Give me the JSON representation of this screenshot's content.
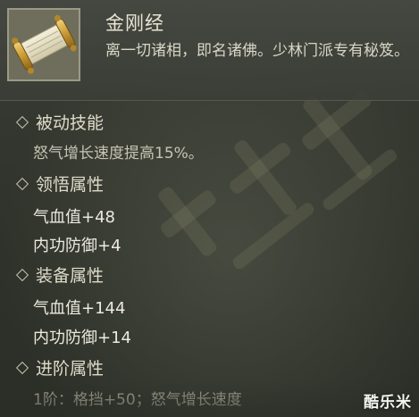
{
  "item": {
    "name": "金刚经",
    "description": "离一切诸相，即名诸佛。少林门派专有秘笈。",
    "icon": "scroll-icon"
  },
  "sections": {
    "passive": {
      "header": "被动技能",
      "text": "怒气增长速度提高15%。"
    },
    "comprehension": {
      "header": "领悟属性",
      "lines": [
        "气血值+48",
        "内功防御+4"
      ]
    },
    "equipment": {
      "header": "装备属性",
      "lines": [
        "气血值+144",
        "内功防御+14"
      ]
    },
    "advanced": {
      "header": "进阶属性",
      "line": "1阶：格挡+50；怒气增长速度"
    }
  },
  "logo": "酷乐米",
  "colors": {
    "title": "#e9e4d2",
    "text": "#eceadf",
    "background": "#34372f"
  }
}
